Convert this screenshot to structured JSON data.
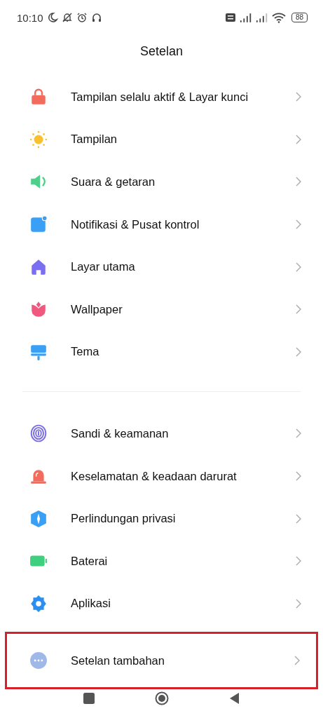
{
  "status_bar": {
    "time": "10:10",
    "battery": "88"
  },
  "title": "Setelan",
  "groups": [
    {
      "items": [
        {
          "kind": "lock",
          "label": "Tampilan selalu aktif & Layar kunci",
          "highlighted": false
        },
        {
          "kind": "sun",
          "label": "Tampilan",
          "highlighted": false
        },
        {
          "kind": "speaker",
          "label": "Suara & getaran",
          "highlighted": false
        },
        {
          "kind": "notification",
          "label": "Notifikasi & Pusat kontrol",
          "highlighted": false
        },
        {
          "kind": "home",
          "label": "Layar utama",
          "highlighted": false
        },
        {
          "kind": "tulip",
          "label": "Wallpaper",
          "highlighted": false
        },
        {
          "kind": "brush",
          "label": "Tema",
          "highlighted": false
        }
      ]
    },
    {
      "items": [
        {
          "kind": "fingerprint",
          "label": "Sandi & keamanan",
          "highlighted": false
        },
        {
          "kind": "siren",
          "label": "Keselamatan & keadaan darurat",
          "highlighted": false
        },
        {
          "kind": "shield",
          "label": "Perlindungan privasi",
          "highlighted": false
        },
        {
          "kind": "battery",
          "label": "Baterai",
          "highlighted": false
        },
        {
          "kind": "gear",
          "label": "Aplikasi",
          "highlighted": false
        },
        {
          "kind": "more",
          "label": "Setelan tambahan",
          "highlighted": true
        }
      ]
    }
  ]
}
